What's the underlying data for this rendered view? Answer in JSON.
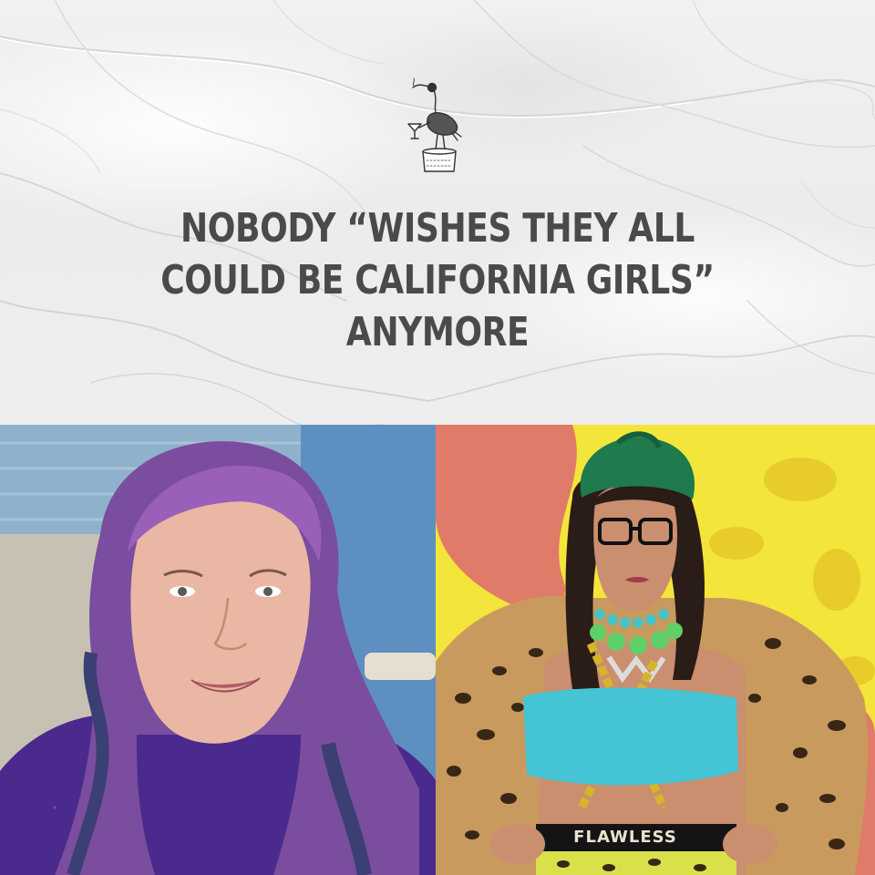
{
  "headline": {
    "line1": "NOBODY “WISHES THEY ALL",
    "line2": "COULD BE CALIFORNIA GIRLS”",
    "line3": "ANYMORE"
  },
  "logo": {
    "icon": "ibis-bird-with-cocktail-icon"
  },
  "photo_right": {
    "belt_text": "FLAWLESS"
  },
  "colors": {
    "headline_text": "#4a4a4a",
    "paper": "#eeeeee",
    "right_background_yellow": "#f4e53a",
    "right_background_coral": "#e07b6a"
  }
}
